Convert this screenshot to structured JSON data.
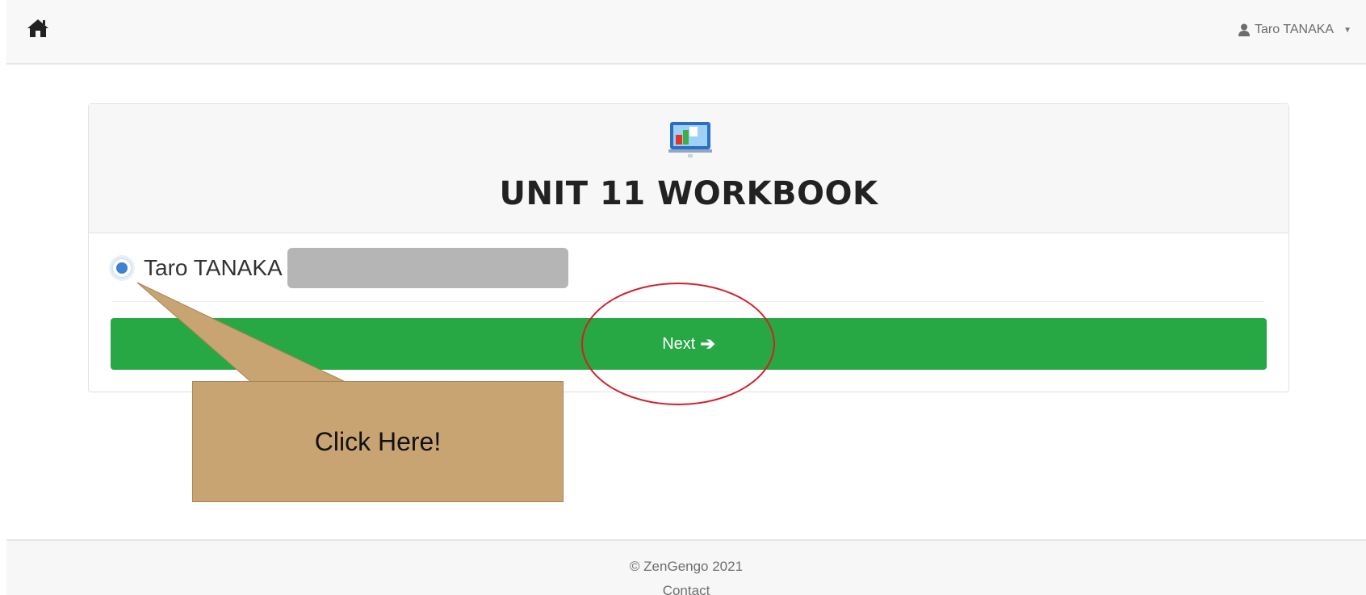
{
  "navbar": {
    "home_icon": "home-icon",
    "user": {
      "icon": "user-icon",
      "name": "Taro TANAKA",
      "caret": "▼"
    }
  },
  "card": {
    "icon": "workbook-icon",
    "title": "UNIT 11 WORKBOOK",
    "student_option": {
      "label": "Taro TANAKA",
      "selected": true
    },
    "next_button": {
      "label": "Next",
      "arrow": "➔"
    }
  },
  "annotation": {
    "callout_text": "Click Here!",
    "callout_color": "#c9a473",
    "highlight_color": "#d21f2a"
  },
  "footer": {
    "copyright": "© ZenGengo 2021",
    "contact": "Contact"
  },
  "colors": {
    "primary_button": "#28a745",
    "radio_selected": "#3b82d4"
  }
}
